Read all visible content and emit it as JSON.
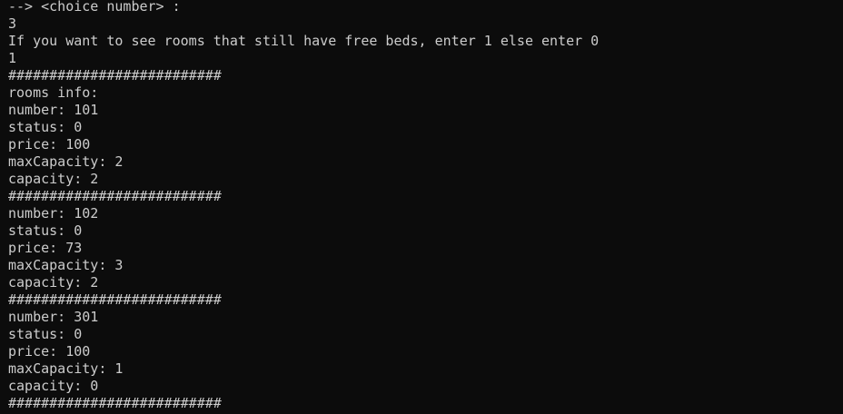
{
  "terminal": {
    "lines": [
      "--> <choice number> :",
      "3",
      "If you want to see rooms that still have free beds, enter 1 else enter 0",
      "1",
      "##########################",
      "rooms info:",
      "number: 101",
      "status: 0",
      "price: 100",
      "maxCapacity: 2",
      "capacity: 2",
      "##########################",
      "number: 102",
      "status: 0",
      "price: 73",
      "maxCapacity: 3",
      "capacity: 2",
      "##########################",
      "number: 301",
      "status: 0",
      "price: 100",
      "maxCapacity: 1",
      "capacity: 0",
      "##########################"
    ]
  }
}
